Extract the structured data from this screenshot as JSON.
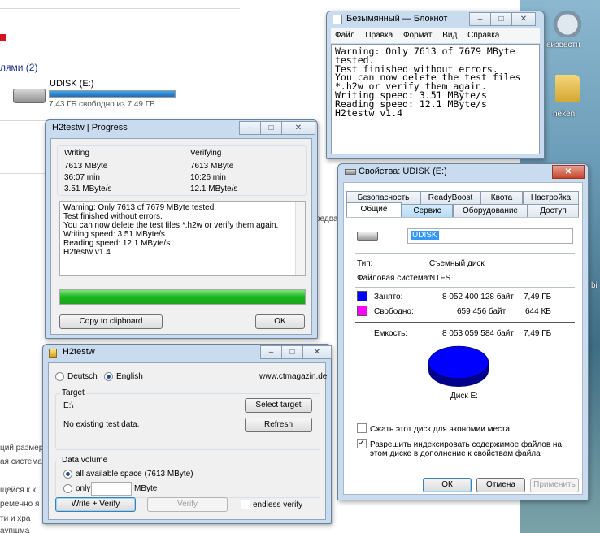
{
  "explorer": {
    "group_header": "лями (2)",
    "drive_name": "UDISK (E:)",
    "drive_free": "7,43 ГБ свободно из 7,49 ГБ",
    "drive_used_fraction": 0.992,
    "fragments": [
      "редва",
      "ций размер",
      "ая система",
      "щейся к к",
      "ременно я",
      "ти и хра",
      "аупшма"
    ]
  },
  "desktop": {
    "icon1": {
      "label": "еизвестн",
      "icon": "recycle-bin-icon"
    },
    "icon2": {
      "label": "neken",
      "icon": "folder-icon"
    },
    "fragment": "bi"
  },
  "notepad": {
    "title": "Безымянный — Блокнот",
    "menu": [
      "Файл",
      "Правка",
      "Формат",
      "Вид",
      "Справка"
    ],
    "text": "Warning: Only 7613 of 7679 MByte\ntested.\nTest finished without errors.\nYou can now delete the test files\n*.h2w or verify them again.\nWriting speed: 3.51 MByte/s\nReading speed: 12.1 MByte/s\nH2testw v1.4"
  },
  "progress": {
    "title": "H2testw | Progress",
    "writing": {
      "label": "Writing",
      "size": "7613 MByte",
      "time": "36:07 min",
      "speed": "3.51 MByte/s"
    },
    "verifying": {
      "label": "Verifying",
      "size": "7613 MByte",
      "time": "10:26 min",
      "speed": "12.1 MByte/s"
    },
    "log": [
      "Warning: Only 7613 of 7679 MByte tested.",
      "Test finished without errors.",
      "You can now delete the test files *.h2w or verify them again.",
      "Writing speed: 3.51 MByte/s",
      "Reading speed: 12.1 MByte/s",
      "H2testw v1.4"
    ],
    "progress_fraction": 1.0,
    "copy_label": "Copy to clipboard",
    "ok_label": "OK"
  },
  "h2testw": {
    "title": "H2testw",
    "lang_de": "Deutsch",
    "lang_en": "English",
    "url": "www.ctmagazin.de",
    "target_label": "Target",
    "target_path": "E:\\",
    "target_status": "No existing test data.",
    "select_target": "Select target",
    "refresh": "Refresh",
    "volume_label": "Data volume",
    "all_space": "all available space (7613 MByte)",
    "only": "only",
    "mbyte": "MByte",
    "write_verify": "Write + Verify",
    "verify": "Verify",
    "endless": "endless verify"
  },
  "properties": {
    "title": "Свойства: UDISK (E:)",
    "tabs_top": [
      "Безопасность",
      "ReadyBoost",
      "Квота",
      "Настройка"
    ],
    "tabs_bottom": [
      "Общие",
      "Сервис",
      "Оборудование",
      "Доступ"
    ],
    "name_value": "UDISK",
    "type_label": "Тип:",
    "type_value": "Съемный диск",
    "fs_label": "Файловая система:",
    "fs_value": "NTFS",
    "used_label": "Занято:",
    "used_bytes": "8 052 400 128 байт",
    "used_size": "7,49 ГБ",
    "free_label": "Свободно:",
    "free_bytes": "659 456 байт",
    "free_size": "644 КБ",
    "cap_label": "Емкость:",
    "cap_bytes": "8 053 059 584 байт",
    "cap_size": "7,49 ГБ",
    "used_color": "#0000ff",
    "free_color": "#ff00ff",
    "disk_label": "Диск E:",
    "compress_label": "Сжать этот диск для экономии места",
    "index_label": "Разрешить индексировать содержимое файлов на этом диске в дополнение к свойствам файла",
    "ok": "ОК",
    "cancel": "Отмена",
    "apply": "Применить"
  }
}
